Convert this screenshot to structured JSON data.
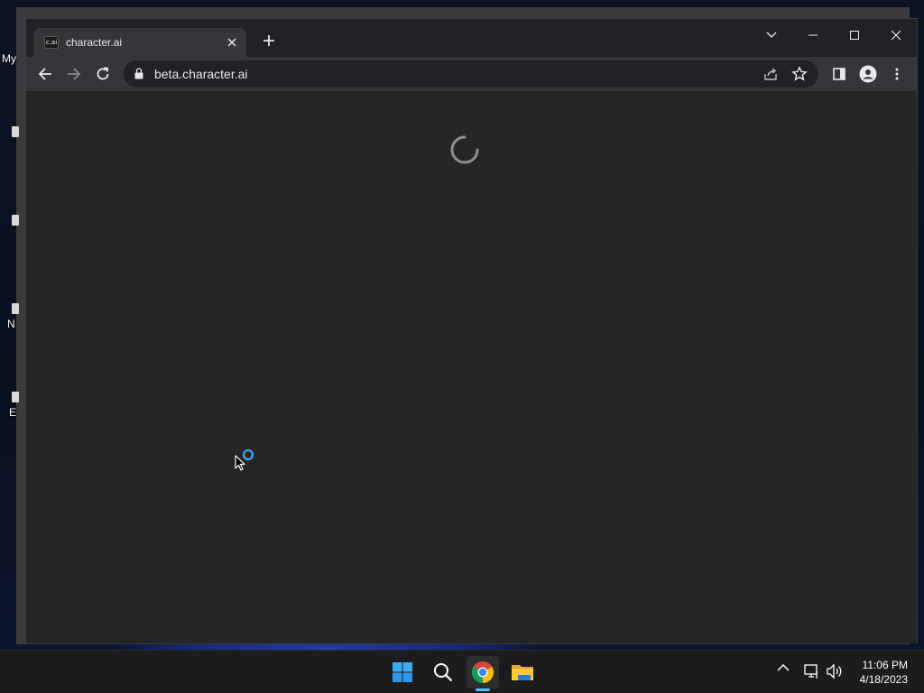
{
  "desktop": {
    "partial_labels": [
      "My",
      "N",
      "E"
    ]
  },
  "browser": {
    "tab": {
      "favicon_text": "c.ai",
      "title": "character.ai"
    },
    "address_bar": {
      "url": "beta.character.ai"
    },
    "page": {
      "state": "loading"
    }
  },
  "taskbar": {
    "apps": [
      {
        "name": "start-icon"
      },
      {
        "name": "search-icon"
      },
      {
        "name": "chrome-icon",
        "active": true
      },
      {
        "name": "file-explorer-icon"
      }
    ],
    "clock": {
      "time": "11:06 PM",
      "date": "4/18/2023"
    }
  },
  "colors": {
    "chrome_frame": "#202124",
    "toolbar": "#35363a",
    "page_bg": "#242525",
    "taskbar": "#1c1c1c",
    "accent": "#4cc2ff"
  }
}
